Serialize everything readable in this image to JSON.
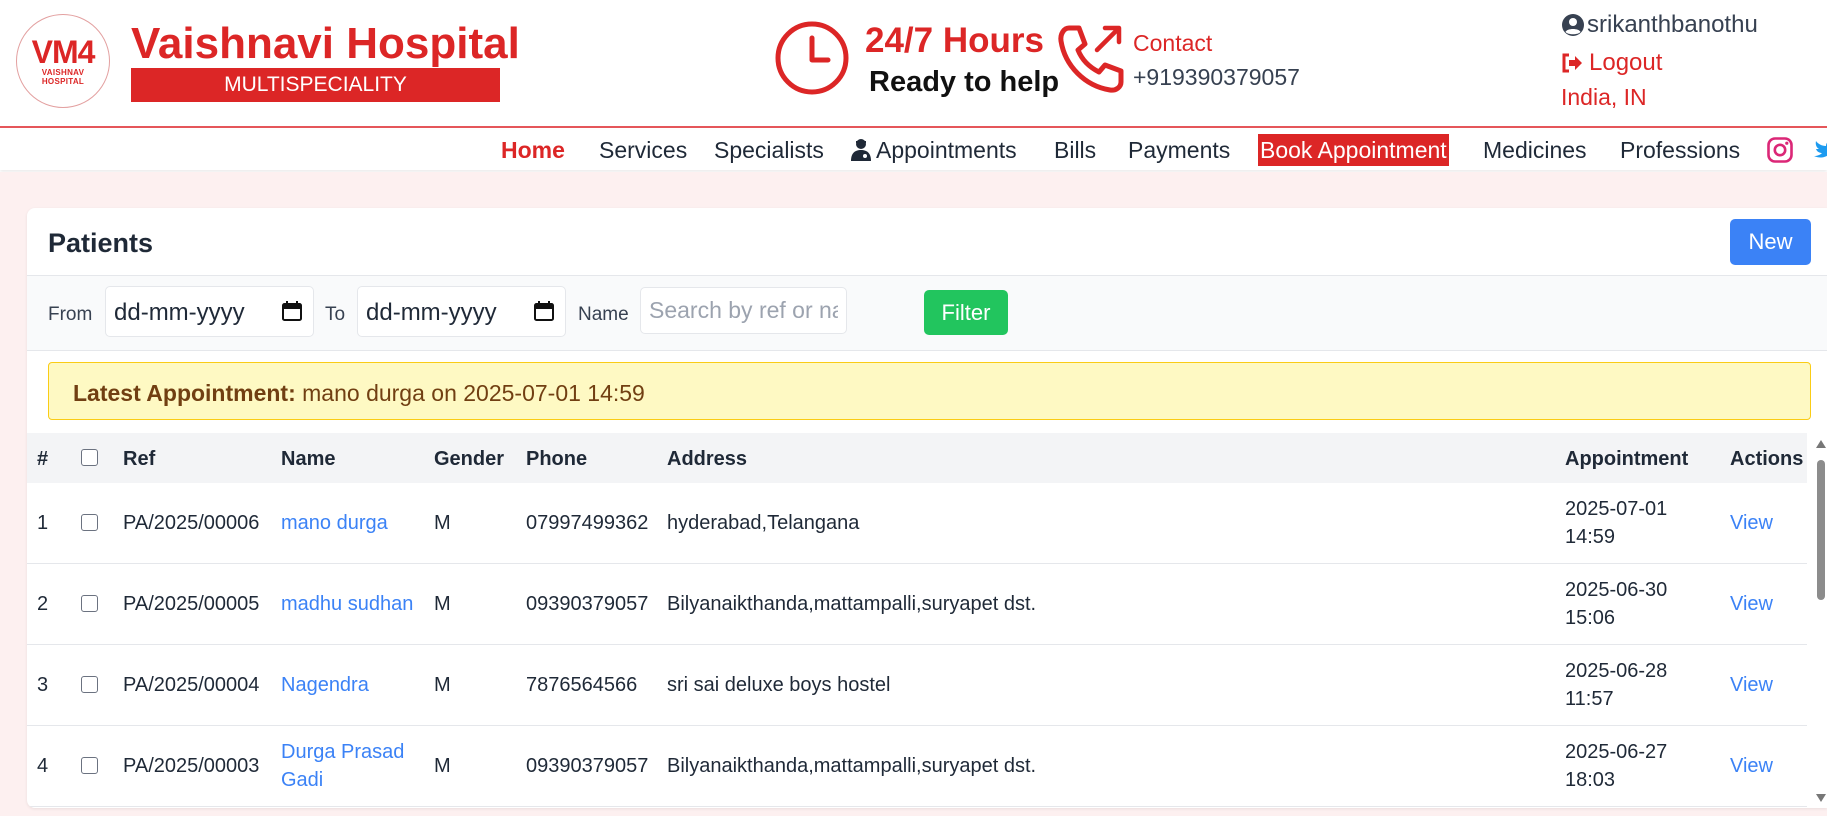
{
  "brand": {
    "logo_mark": "VM4",
    "logo_small_1": "VAISHNAV",
    "logo_small_2": "HOSPITAL",
    "name": "Vaishnavi Hospital",
    "tagline": "MULTISPECIALITY"
  },
  "hours": {
    "title": "24/7 Hours",
    "subtitle": "Ready to help"
  },
  "contact": {
    "label": "Contact",
    "phone": "+919390379057"
  },
  "user": {
    "username": "srikanthbanothu",
    "logout_label": "Logout",
    "locale": "India, IN"
  },
  "nav": {
    "home": "Home",
    "services": "Services",
    "specialists": "Specialists",
    "appointments": "Appointments",
    "bills": "Bills",
    "payments": "Payments",
    "book": "Book Appointment",
    "medicines": "Medicines",
    "professions": "Professions"
  },
  "patients": {
    "title": "Patients",
    "new_label": "New",
    "filter": {
      "from_label": "From",
      "from_value": "dd-mm-yyyy",
      "to_label": "To",
      "to_value": "dd-mm-yyyy",
      "name_label": "Name",
      "name_placeholder": "Search by ref or name",
      "button": "Filter"
    },
    "latest": {
      "label": "Latest Appointment:",
      "text": "mano durga on 2025-07-01 14:59"
    },
    "columns": {
      "num": "#",
      "ref": "Ref",
      "name": "Name",
      "gender": "Gender",
      "phone": "Phone",
      "address": "Address",
      "appointment": "Appointment",
      "actions": "Actions"
    },
    "rows": [
      {
        "num": "1",
        "ref": "PA/2025/00006",
        "name": "mano durga",
        "name_line2": "",
        "gender": "M",
        "phone": "07997499362",
        "address": "hyderabad,Telangana",
        "date": "2025-07-01",
        "time": "14:59",
        "action": "View"
      },
      {
        "num": "2",
        "ref": "PA/2025/00005",
        "name": "madhu sudhan",
        "name_line2": "",
        "gender": "M",
        "phone": "09390379057",
        "address": "Bilyanaikthanda,mattampalli,suryapet dst.",
        "date": "2025-06-30",
        "time": "15:06",
        "action": "View"
      },
      {
        "num": "3",
        "ref": "PA/2025/00004",
        "name": "Nagendra",
        "name_line2": "",
        "gender": "M",
        "phone": "7876564566",
        "address": "sri sai deluxe boys hostel",
        "date": "2025-06-28",
        "time": "11:57",
        "action": "View"
      },
      {
        "num": "4",
        "ref": "PA/2025/00003",
        "name": "Durga Prasad",
        "name_line2": "Gadi",
        "gender": "M",
        "phone": "09390379057",
        "address": "Bilyanaikthanda,mattampalli,suryapet dst.",
        "date": "2025-06-27",
        "time": "18:03",
        "action": "View"
      }
    ]
  },
  "colors": {
    "brand_red": "#dc2626",
    "primary_blue": "#3b82f6",
    "success_green": "#22c55e",
    "alert_bg": "#fef9c3"
  }
}
